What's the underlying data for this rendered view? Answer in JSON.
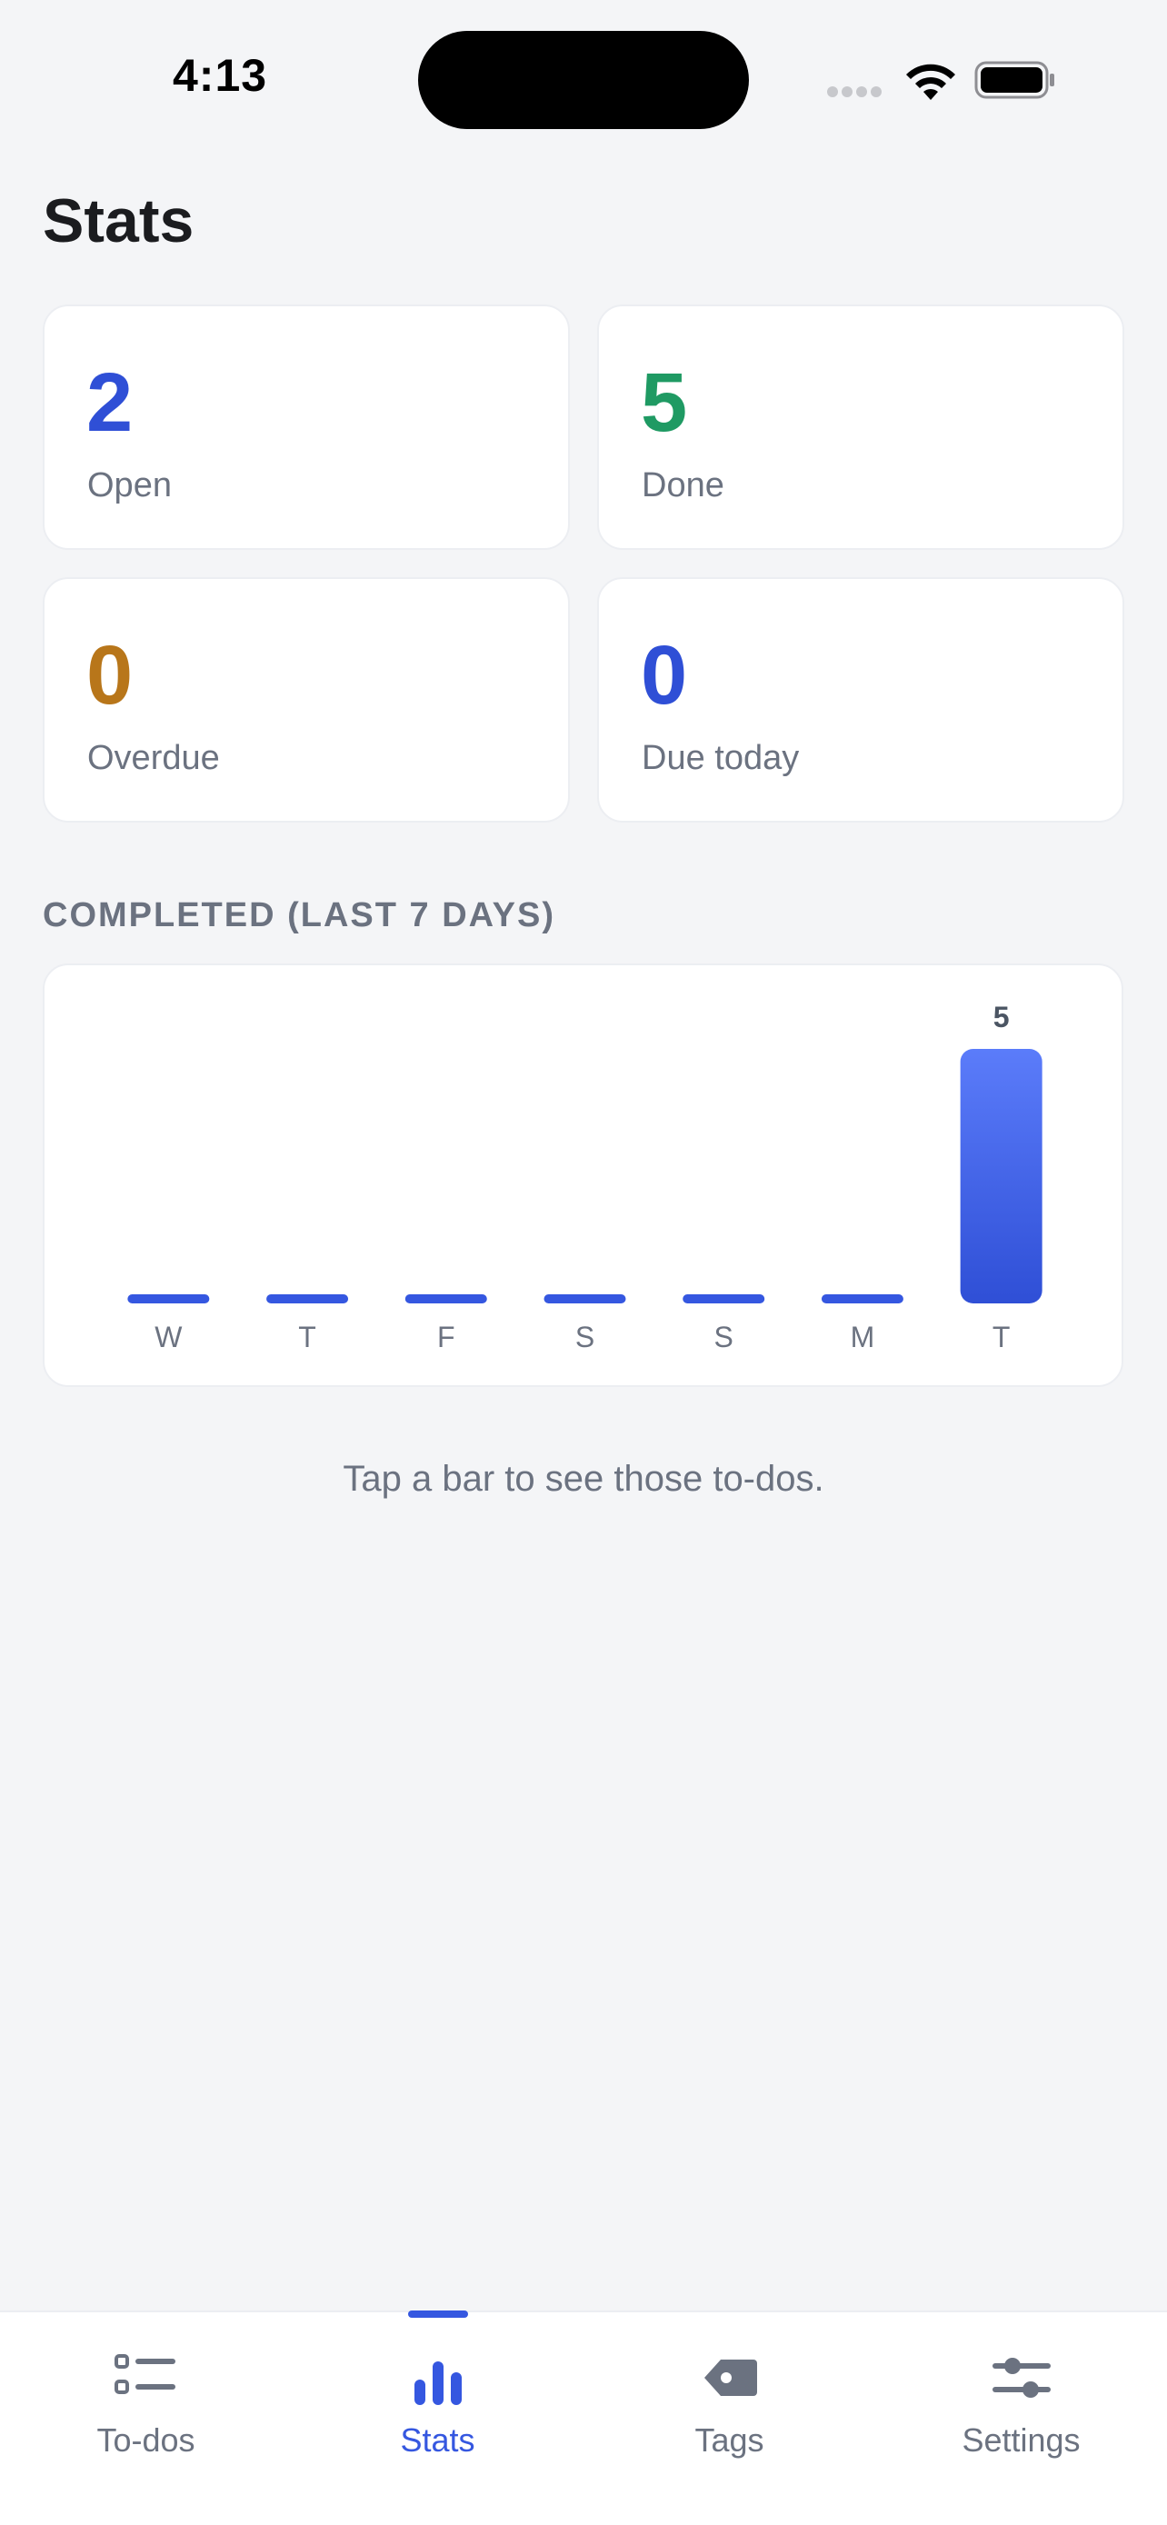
{
  "status_bar": {
    "time": "4:13"
  },
  "page_title": "Stats",
  "colors": {
    "accent": "#3557e0",
    "green": "#1f9a63",
    "amber": "#b8761a",
    "muted": "#6b7280"
  },
  "stats": [
    {
      "value": "2",
      "label": "Open",
      "color": "#2f4fd6"
    },
    {
      "value": "5",
      "label": "Done",
      "color": "#1f9a63"
    },
    {
      "value": "0",
      "label": "Overdue",
      "color": "#b8761a"
    },
    {
      "value": "0",
      "label": "Due today",
      "color": "#2f4fd6"
    }
  ],
  "section_title": "COMPLETED (LAST 7 DAYS)",
  "chart_data": {
    "type": "bar",
    "categories": [
      "W",
      "T",
      "F",
      "S",
      "S",
      "M",
      "T"
    ],
    "values": [
      0,
      0,
      0,
      0,
      0,
      0,
      5
    ],
    "data_labels": [
      "",
      "",
      "",
      "",
      "",
      "",
      "5"
    ],
    "ylim": [
      0,
      5
    ],
    "grid": false
  },
  "hint": "Tap a bar to see those to-dos.",
  "tabs": [
    {
      "label": "To-dos",
      "icon": "list-icon",
      "active": false
    },
    {
      "label": "Stats",
      "icon": "bar-chart-icon",
      "active": true
    },
    {
      "label": "Tags",
      "icon": "tag-icon",
      "active": false
    },
    {
      "label": "Settings",
      "icon": "sliders-icon",
      "active": false
    }
  ]
}
